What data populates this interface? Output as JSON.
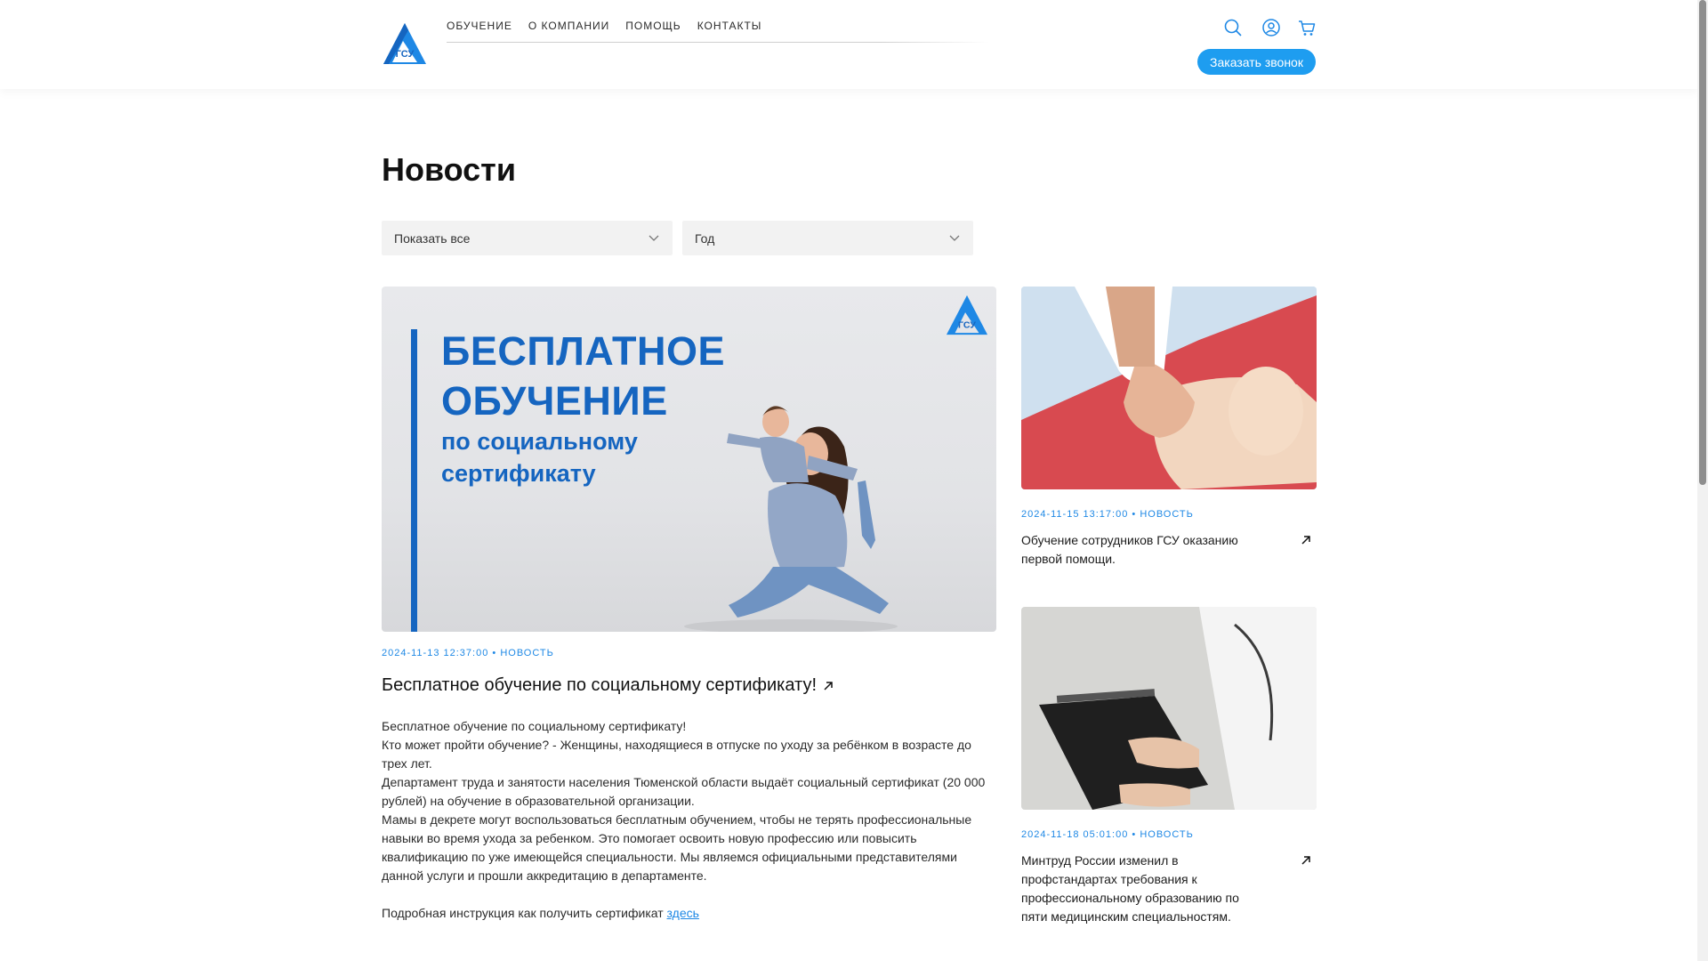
{
  "header": {
    "nav": [
      "Обучение",
      "О компании",
      "Помощь",
      "Контакты"
    ],
    "logo_text": "ГСУ",
    "call_button": "Заказать звонок",
    "icons": [
      "search-icon",
      "user-icon",
      "cart-icon"
    ],
    "accent": "#1e9df0"
  },
  "page": {
    "title": "Новости",
    "filter_category": "Показать все",
    "filter_year": "Год"
  },
  "featured": {
    "image_text_1": "БЕСПЛАТНОЕ",
    "image_text_2": "ОБУЧЕНИЕ",
    "image_text_3": "по социальному",
    "image_text_4": "сертификату",
    "date": "2024-11-13 12:37:00",
    "tag": "НОВОСТЬ",
    "title": "Бесплатное обучение по социальному сертификату!",
    "body": [
      "Бесплатное обучение по социальному сертификату!",
      "Кто может пройти обучение? - Женщины, находящиеся в отпуске по уходу за ребёнком в возрасте до трех лет.",
      "Департамент труда и занятости населения Тюменской области выдаёт социальный сертификат (20 000 рублей) на обучение в образовательной организации.",
      "Мамы в декрете могут воспользоваться бесплатным обучением, чтобы не терять профессиональные навыки во время ухода за ребенком. Это помогает освоить новую профессию или повысить квалификацию по уже имеющейся специальности. Мы являемся официальными представителями данной услуги и прошли аккредитацию в департаменте."
    ],
    "instruction_text": "Подробная инструкция как получить сертификат",
    "instruction_link": "здесь"
  },
  "side_news": [
    {
      "date": "2024-11-15 13:17:00",
      "tag": "НОВОСТЬ",
      "title": "Обучение сотрудников ГСУ оказанию первой помощи."
    },
    {
      "date": "2024-11-18 05:01:00",
      "tag": "НОВОСТЬ",
      "title": "Минтруд России изменил в профстандартах требования к профессиональному образованию по пяти медицинским специальностям."
    }
  ]
}
